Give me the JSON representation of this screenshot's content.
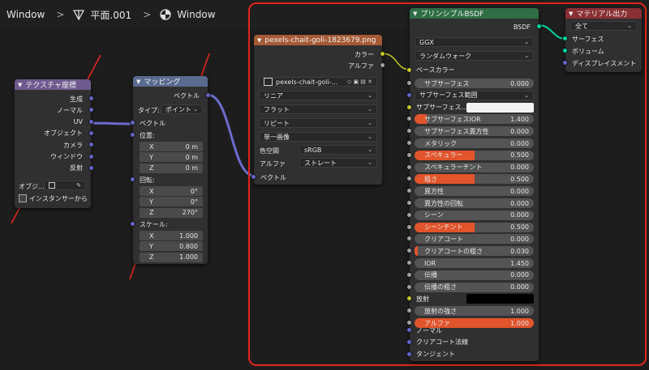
{
  "header": {
    "items": [
      "Window",
      "平面.001",
      "Window"
    ]
  },
  "colors": {
    "bsdf_header": "#2f6e45",
    "image_header": "#a65a36",
    "coord_header": "#6f5a8f",
    "map_header": "#5a6b8f",
    "output_header": "#8a2f32",
    "accent_fill": "#e2542b",
    "highlight_box": "#e0261c"
  },
  "tex_coord": {
    "title": "テクスチャ座標",
    "outputs": [
      "生成",
      "ノーマル",
      "UV",
      "オブジェクト",
      "カメラ",
      "ウィンドウ",
      "反射"
    ],
    "object_label": "オブジ...",
    "instancer_label": "インスタンサーから"
  },
  "mapping": {
    "title": "マッピング",
    "out": "ベクトル",
    "type_label": "タイプ:",
    "type_value": "ポイント",
    "in_vector": "ベクトル",
    "loc_label": "位置:",
    "loc": [
      {
        "a": "X",
        "v": "0 m"
      },
      {
        "a": "Y",
        "v": "0 m"
      },
      {
        "a": "Z",
        "v": "0 m"
      }
    ],
    "rot_label": "回転:",
    "rot": [
      {
        "a": "X",
        "v": "0°"
      },
      {
        "a": "Y",
        "v": "0°"
      },
      {
        "a": "Z",
        "v": "270°"
      }
    ],
    "scale_label": "スケール:",
    "scale": [
      {
        "a": "X",
        "v": "1.000"
      },
      {
        "a": "Y",
        "v": "0.800"
      },
      {
        "a": "Z",
        "v": "1.000"
      }
    ]
  },
  "image": {
    "title": "pexels-chait-goli-1823679.png",
    "out_color": "カラー",
    "out_alpha": "アルファ",
    "file": "pexels-chait-goli-...",
    "interp": "リニア",
    "proj": "フラット",
    "ext": "リピート",
    "source": "単一画像",
    "cs_label": "色空間",
    "cs_value": "sRGB",
    "alpha_label": "アルファ",
    "alpha_value": "ストレート",
    "in_vector": "ベクトル"
  },
  "bsdf": {
    "title": "プリンシプルBSDF",
    "out": "BSDF",
    "dist": "GGX",
    "sss_method": "ランダムウォーク",
    "base_color": "ベースカラー",
    "rows": [
      {
        "label": "サブサーフェス",
        "value": "0.000",
        "fill": 0
      },
      {
        "label": "サブサーフェス範囲",
        "value": "",
        "fill": 0,
        "kind": "dd"
      },
      {
        "label": "サブサーフェス...",
        "value": "",
        "fill": 0,
        "kind": "color"
      },
      {
        "label": "サブサーフェスIOR",
        "value": "1.400",
        "fill": 0.1
      },
      {
        "label": "サブサーフェス異方性",
        "value": "0.000",
        "fill": 0
      },
      {
        "label": "メタリック",
        "value": "0.000",
        "fill": 0
      },
      {
        "label": "スペキュラー",
        "value": "0.500",
        "fill": 0.5
      },
      {
        "label": "スペキュラーチント",
        "value": "0.000",
        "fill": 0
      },
      {
        "label": "粗さ",
        "value": "0.500",
        "fill": 0.5
      },
      {
        "label": "異方性",
        "value": "0.000",
        "fill": 0
      },
      {
        "label": "異方性の回転",
        "value": "0.000",
        "fill": 0
      },
      {
        "label": "シーン",
        "value": "0.000",
        "fill": 0
      },
      {
        "label": "シーンチント",
        "value": "0.500",
        "fill": 0.5
      },
      {
        "label": "クリアコート",
        "value": "0.000",
        "fill": 0
      },
      {
        "label": "クリアコートの粗さ",
        "value": "0.030",
        "fill": 0.03
      },
      {
        "label": "IOR",
        "value": "1.450",
        "fill": 0
      },
      {
        "label": "伝播",
        "value": "0.000",
        "fill": 0
      },
      {
        "label": "伝播の粗さ",
        "value": "0.000",
        "fill": 0
      },
      {
        "label": "放射",
        "value": "",
        "fill": 0,
        "kind": "emit"
      },
      {
        "label": "放射の強さ",
        "value": "1.000",
        "fill": 0
      },
      {
        "label": "アルファ",
        "value": "1.000",
        "fill": 1
      }
    ],
    "inputs_bottom": [
      "ノーマル",
      "クリアコート法線",
      "タンジェント"
    ]
  },
  "output": {
    "title": "マテリアル出力",
    "target": "全て",
    "inputs": [
      "サーフェス",
      "ボリューム",
      "ディスプレイスメント"
    ]
  }
}
